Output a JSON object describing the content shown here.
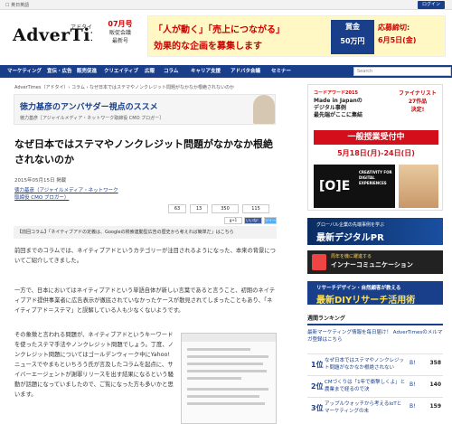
{
  "topbar": {
    "language": "☐ 英日英語",
    "login": "ログイン"
  },
  "logo": {
    "main": "AdverTimes.",
    "sub": "アドタイ"
  },
  "promo": {
    "line1": "07月号",
    "line2": "販促会議",
    "line3": "最新号"
  },
  "banner": {
    "line1": "「人が動く」「売上につながる」",
    "line2": "効果的な企画を募集します",
    "prize_label": "賞金",
    "prize_value": "50万円",
    "deadline_label": "応募締切:",
    "deadline_value": "6月5日(金)"
  },
  "nav": {
    "items": [
      "マーケティング",
      "宣伝・広告",
      "販売促進",
      "クリエイティブ",
      "広報",
      "コラム",
      "キャリア支援",
      "アドバタ会議",
      "セミナー"
    ],
    "search_placeholder": "Search"
  },
  "breadcrumb": "AdverTimes（アドタイ）› コラム › なぜ日本ではステマやノンクレジット問題がなかなか根絶されないのか",
  "series": {
    "title": "徳力基彦のアンバサダー視点のススメ",
    "author_line": "徳力基彦［アジャイルメディア・ネットワーク取締役 CMO ブロガー］"
  },
  "article": {
    "title": "なぜ日本ではステマやノンクレジット問題がなかなか根絶されないのか",
    "date": "2015年05月15日 掲載",
    "author": "徳力基彦（アジャイルメディア・ネットワーク取締役 CMO ブロガー）",
    "summary": "【前回コラム】「ネイティブアドの定義は、Googleの検索連動型広告の歴史から考えれば簡単だ」はこちら",
    "para1": "前回までのコラムでは、ネイティブアドというカテゴリーが注目されるようになった、本来の背景についてご紹介してきました。",
    "para2": "一方で、日本においてはネイティブアドという単語自体が新しい言葉であると言うこと、初期のネイティブアド提供事業者に広告表示が徹底されていなかったケースが散見されてしまったこともあり、「ネイティブアド＝ステマ」と誤解している人も少なくないようです。",
    "para3": "その象徴と言われる問題が、ネイティブアドというキーワードを使ったステマ手法やノンクレジット問題でしょう。丁度、ノンクレジット問題についてはゴールデンウィーク中にYahoo!ニュースでやまもといちろう氏が言及したコラムを起点に、サイバーエージェントが謝罪リリースを出す結果になるという騒動が話題になっていましたので、ご覧になった方も多いかと思います。"
  },
  "social": {
    "count1": "13",
    "like": "350",
    "tweet": "115",
    "hatena": "63",
    "gplus": "g+1",
    "share": "いいね！",
    "tw_label": "ツイート"
  },
  "right": {
    "ad1": {
      "tag": "コードアワード2015",
      "headline": "Made in Japanの\nデジタル事例\n最先端がここに集結",
      "finalist": "ファイナリスト\n27作品\n決定!",
      "bar": "一般授業受付中",
      "dates": "5月18日(月)-24日(日)",
      "cube": "[O]E",
      "cube_note": "CREATIVITY FOR DIGITAL EXPERIENCES"
    },
    "ad2": {
      "sub": "グローバル企業の先端事例を学ぶ",
      "main": "最新デジタルPR"
    },
    "ad3": {
      "sub": "周年を機に躍進する",
      "main": "インナーコミュニケーション"
    },
    "ad4": {
      "sub": "リサーチデザイン・自然顧客が教える",
      "main": "最新DIYリサーチ活用術"
    }
  },
  "ranking": {
    "heading": "週間ランキング",
    "promo": "最新マーケティング情報を毎日届け！ AdverTimesのメルマガ登録はこちら",
    "items": [
      {
        "rank": "1位",
        "title": "なぜ日本ではステマやノンクレジット問題がなかなか根絶されない",
        "count": "358"
      },
      {
        "rank": "2位",
        "title": "CMづくりは「1年で衝撃しくよ」と農業まで経るので決",
        "count": "140"
      },
      {
        "rank": "3位",
        "title": "アップルウォッチから考えるIoTとマーケティングの未",
        "count": "159"
      }
    ]
  }
}
